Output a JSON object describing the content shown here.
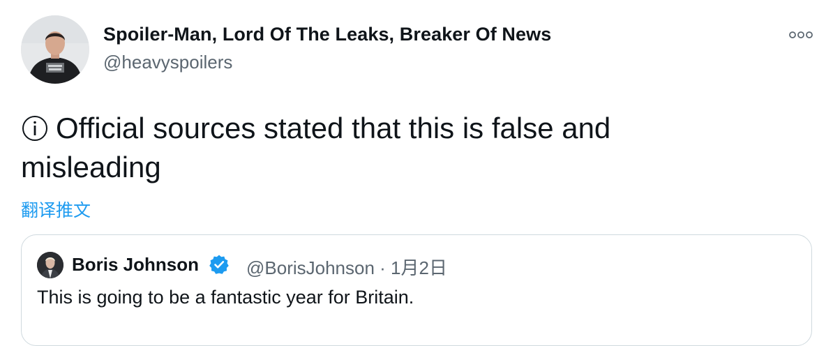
{
  "author": {
    "display_name": "Spoiler-Man, Lord Of The Leaks, Breaker Of News",
    "handle": "@heavyspoilers",
    "avatar_icon": "profile-photo"
  },
  "more_menu": {
    "icon": "more-horizontal-icon"
  },
  "tweet": {
    "info_icon": "info-circle-icon",
    "text": "Official sources stated that this is false and misleading"
  },
  "translate": {
    "label": "翻译推文"
  },
  "quoted_tweet": {
    "display_name": "Boris Johnson",
    "verified": true,
    "meta": "@BorisJohnson · 1月2日",
    "text": "This is going to be a fantastic year for Britain."
  },
  "colors": {
    "text": "#0f1419",
    "secondary": "#5b6670",
    "link": "#1d9bf0",
    "border": "#cfd9de",
    "verified": "#1d9bf0"
  }
}
